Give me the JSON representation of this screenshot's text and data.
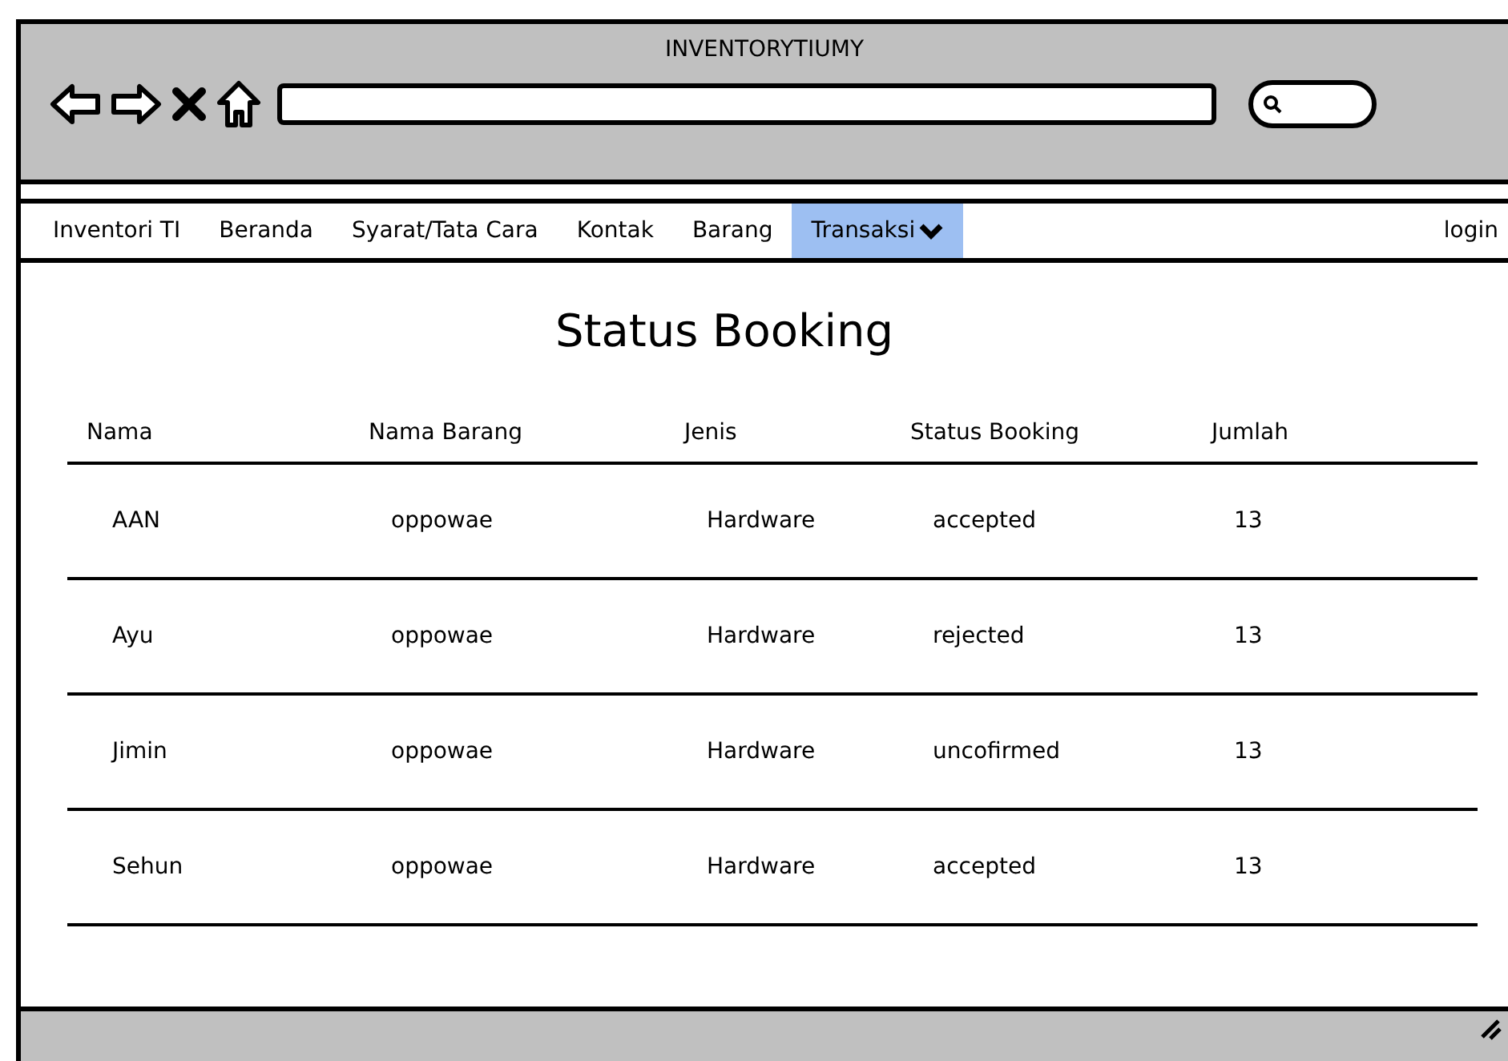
{
  "window": {
    "title": "INVENTORYTIUMY"
  },
  "nav": {
    "items": [
      {
        "label": "Inventori TI",
        "selected": false
      },
      {
        "label": "Beranda",
        "selected": false
      },
      {
        "label": "Syarat/Tata Cara",
        "selected": false
      },
      {
        "label": "Kontak",
        "selected": false
      },
      {
        "label": "Barang",
        "selected": false
      },
      {
        "label": "Transaksi",
        "selected": true,
        "dropdown": true
      }
    ],
    "login": "login"
  },
  "heading": "Status Booking",
  "table": {
    "columns": [
      "Nama",
      "Nama Barang",
      "Jenis",
      "Status Booking",
      "Jumlah"
    ],
    "rows": [
      [
        "AAN",
        "oppowae",
        "Hardware",
        "accepted",
        "13"
      ],
      [
        "Ayu",
        "oppowae",
        "Hardware",
        "rejected",
        "13"
      ],
      [
        "Jimin",
        "oppowae",
        "Hardware",
        "uncofirmed",
        "13"
      ],
      [
        "Sehun",
        "oppowae",
        "Hardware",
        "accepted",
        "13"
      ]
    ]
  }
}
